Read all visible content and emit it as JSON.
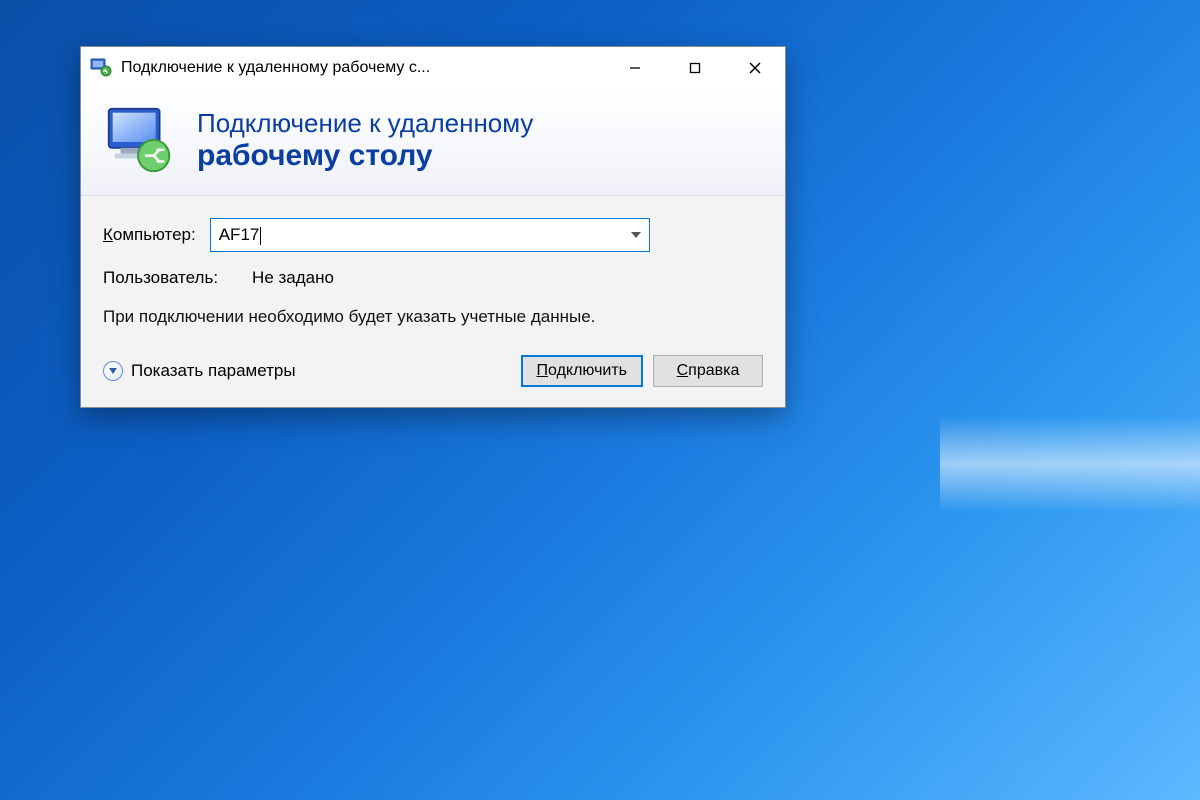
{
  "window": {
    "title": "Подключение к удаленному рабочему с..."
  },
  "banner": {
    "line1": "Подключение к удаленному",
    "line2": "рабочему столу"
  },
  "form": {
    "computer_label": "Компьютер:",
    "computer_value": "AF17",
    "user_label": "Пользователь:",
    "user_value": "Не задано",
    "hint": "При подключении необходимо будет указать учетные данные."
  },
  "footer": {
    "show_params": "Показать параметры",
    "connect": "Подключить",
    "help": "Справка"
  }
}
